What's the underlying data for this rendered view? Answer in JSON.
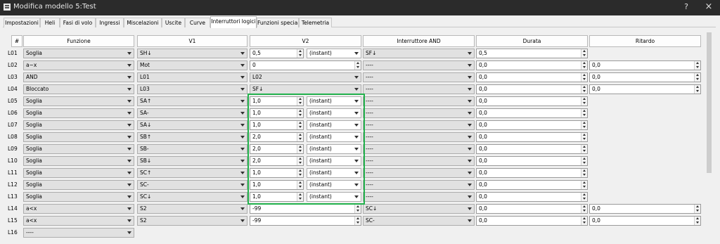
{
  "window": {
    "title": "Modifica modello 5:Test",
    "help": "?",
    "close": "×"
  },
  "tabs": [
    {
      "label": "Impostazioni"
    },
    {
      "label": "Heli"
    },
    {
      "label": "Fasi di volo"
    },
    {
      "label": "Ingressi"
    },
    {
      "label": "Miscelazioni"
    },
    {
      "label": "Uscite"
    },
    {
      "label": "Curve"
    },
    {
      "label": "Interruttori logici"
    },
    {
      "label": "Funzioni speciali"
    },
    {
      "label": "Telemetria"
    }
  ],
  "active_tab": "Interruttori logici",
  "headers": {
    "num": "#",
    "funzione": "Funzione",
    "v1": "V1",
    "v2": "V2",
    "and": "Interruttore AND",
    "durata": "Durata",
    "ritardo": "Ritardo"
  },
  "rows": [
    {
      "id": "L01",
      "funzione": "Soglia",
      "v1": "SH↓",
      "v2_value": "0,5",
      "v2_unit": "(instant)",
      "and": "SF↓",
      "durata": "0,5",
      "ritardo": ""
    },
    {
      "id": "L02",
      "funzione": "a~x",
      "v1": "Mot",
      "v2_value": "0",
      "v2_unit": "",
      "and": "----",
      "durata": "0,0",
      "ritardo": "0,0"
    },
    {
      "id": "L03",
      "funzione": "AND",
      "v1": "L01",
      "v2_value": "L02",
      "v2_unit": "",
      "and": "----",
      "durata": "0,0",
      "ritardo": "0,0"
    },
    {
      "id": "L04",
      "funzione": "Bloccato",
      "v1": "L03",
      "v2_value": "SF↓",
      "v2_unit": "",
      "and": "----",
      "durata": "0,0",
      "ritardo": "0,0"
    },
    {
      "id": "L05",
      "funzione": "Soglia",
      "v1": "SA↑",
      "v2_value": "1,0",
      "v2_unit": "(instant)",
      "and": "----",
      "durata": "0,0",
      "ritardo": ""
    },
    {
      "id": "L06",
      "funzione": "Soglia",
      "v1": "SA-",
      "v2_value": "1,0",
      "v2_unit": "(instant)",
      "and": "----",
      "durata": "0,0",
      "ritardo": ""
    },
    {
      "id": "L07",
      "funzione": "Soglia",
      "v1": "SA↓",
      "v2_value": "1,0",
      "v2_unit": "(instant)",
      "and": "----",
      "durata": "0,0",
      "ritardo": ""
    },
    {
      "id": "L08",
      "funzione": "Soglia",
      "v1": "SB↑",
      "v2_value": "2,0",
      "v2_unit": "(instant)",
      "and": "----",
      "durata": "0,0",
      "ritardo": ""
    },
    {
      "id": "L09",
      "funzione": "Soglia",
      "v1": "SB-",
      "v2_value": "2,0",
      "v2_unit": "(instant)",
      "and": "----",
      "durata": "0,0",
      "ritardo": ""
    },
    {
      "id": "L10",
      "funzione": "Soglia",
      "v1": "SB↓",
      "v2_value": "2,0",
      "v2_unit": "(instant)",
      "and": "----",
      "durata": "0,0",
      "ritardo": ""
    },
    {
      "id": "L11",
      "funzione": "Soglia",
      "v1": "SC↑",
      "v2_value": "1,0",
      "v2_unit": "(instant)",
      "and": "----",
      "durata": "0,0",
      "ritardo": ""
    },
    {
      "id": "L12",
      "funzione": "Soglia",
      "v1": "SC-",
      "v2_value": "1,0",
      "v2_unit": "(instant)",
      "and": "----",
      "durata": "0,0",
      "ritardo": ""
    },
    {
      "id": "L13",
      "funzione": "Soglia",
      "v1": "SC↓",
      "v2_value": "1,0",
      "v2_unit": "(instant)",
      "and": "----",
      "durata": "0,0",
      "ritardo": ""
    },
    {
      "id": "L14",
      "funzione": "a<x",
      "v1": "S2",
      "v2_value": "-99",
      "v2_unit": "",
      "and": "SC↓",
      "durata": "0,0",
      "ritardo": "0,0"
    },
    {
      "id": "L15",
      "funzione": "a<x",
      "v1": "S2",
      "v2_value": "-99",
      "v2_unit": "",
      "and": "SC-",
      "durata": "0,0",
      "ritardo": "0,0"
    },
    {
      "id": "L16",
      "funzione": "----",
      "v1": "",
      "v2_value": "",
      "v2_unit": "",
      "and": "",
      "durata": "",
      "ritardo": ""
    }
  ],
  "colors": {
    "highlight": "#22b14c",
    "titlebar": "#2b2b2b"
  }
}
